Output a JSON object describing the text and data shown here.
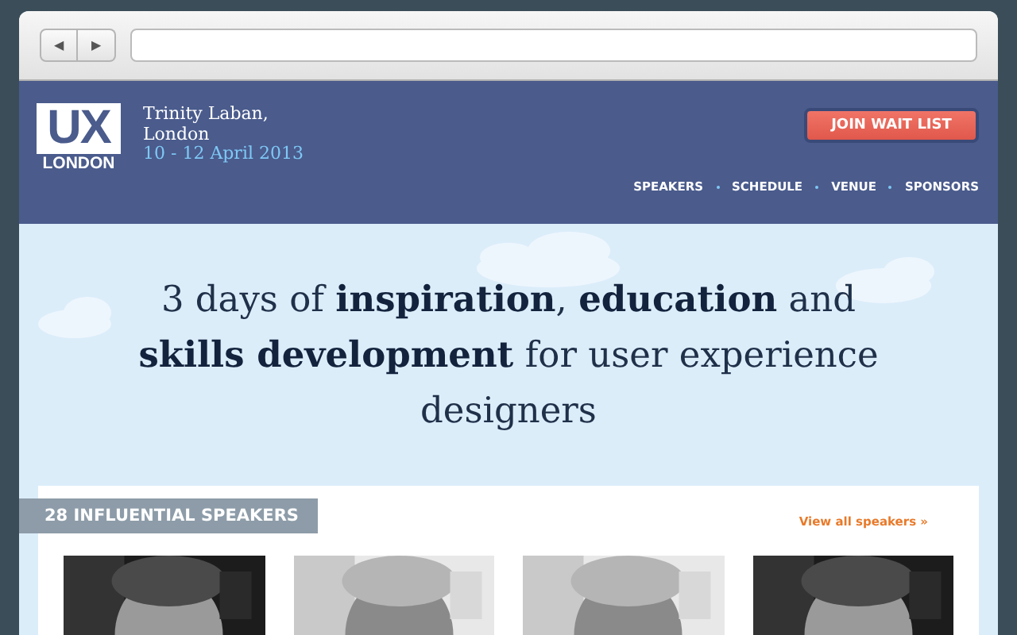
{
  "browser": {
    "back": "◀",
    "forward": "▶"
  },
  "header": {
    "logo_main": "UX",
    "logo_sub": "LONDON",
    "venue": "Trinity Laban,",
    "city": "London",
    "dates": "10 - 12 April 2013",
    "cta": "JOIN WAIT LIST",
    "nav": [
      "SPEAKERS",
      "SCHEDULE",
      "VENUE",
      "SPONSORS"
    ]
  },
  "hero": {
    "headline": "3 days of **inspiration**, **education** and **skills development** for user experience designers"
  },
  "speakers": {
    "title": "28 INFLUENTIAL SPEAKERS",
    "link": "View all speakers »"
  }
}
